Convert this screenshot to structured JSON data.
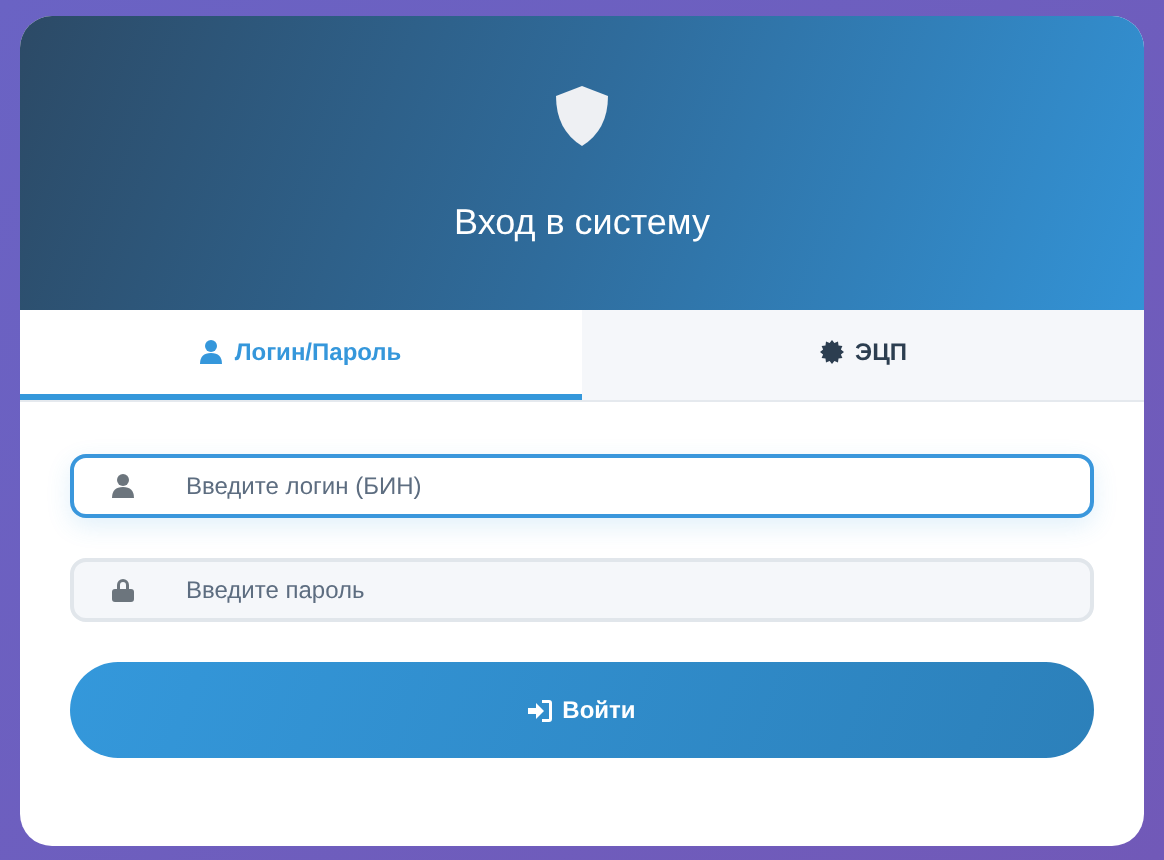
{
  "header": {
    "title": "Вход в систему"
  },
  "tabs": [
    {
      "label": "Логин/Пароль",
      "kind": "user",
      "selected": true
    },
    {
      "label": "ЭЦП",
      "kind": "badge",
      "selected": false
    }
  ],
  "fields": [
    {
      "placeholder": "Введите логин (БИН)",
      "kind": "user",
      "focused": true
    },
    {
      "placeholder": "Введите пароль",
      "kind": "lock",
      "focused": false
    }
  ],
  "submit": {
    "label": "Войти"
  }
}
